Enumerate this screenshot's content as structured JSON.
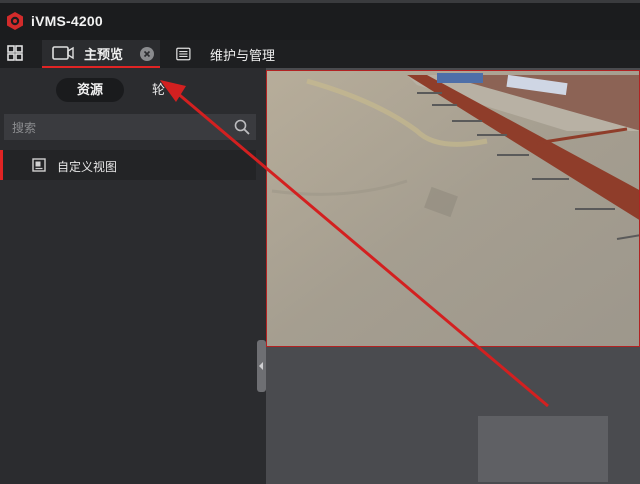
{
  "app": {
    "title": "iVMS-4200"
  },
  "tabs": {
    "preview": {
      "label": "主预览"
    },
    "maintenance": {
      "label": "维护与管理"
    }
  },
  "left_panel": {
    "segments": {
      "resources": "资源",
      "other": "轮"
    },
    "search": {
      "placeholder": "搜索"
    },
    "tree": {
      "custom_view": "自定义视图"
    }
  },
  "colors": {
    "accent": "#e02424",
    "bg_dark": "#1b1c1e",
    "panel": "#2b2c2f"
  },
  "icons": [
    "logo-icon",
    "grid-menu-icon",
    "camera-icon",
    "close-icon",
    "list-icon",
    "search-icon",
    "view-icon",
    "collapse-icon"
  ]
}
